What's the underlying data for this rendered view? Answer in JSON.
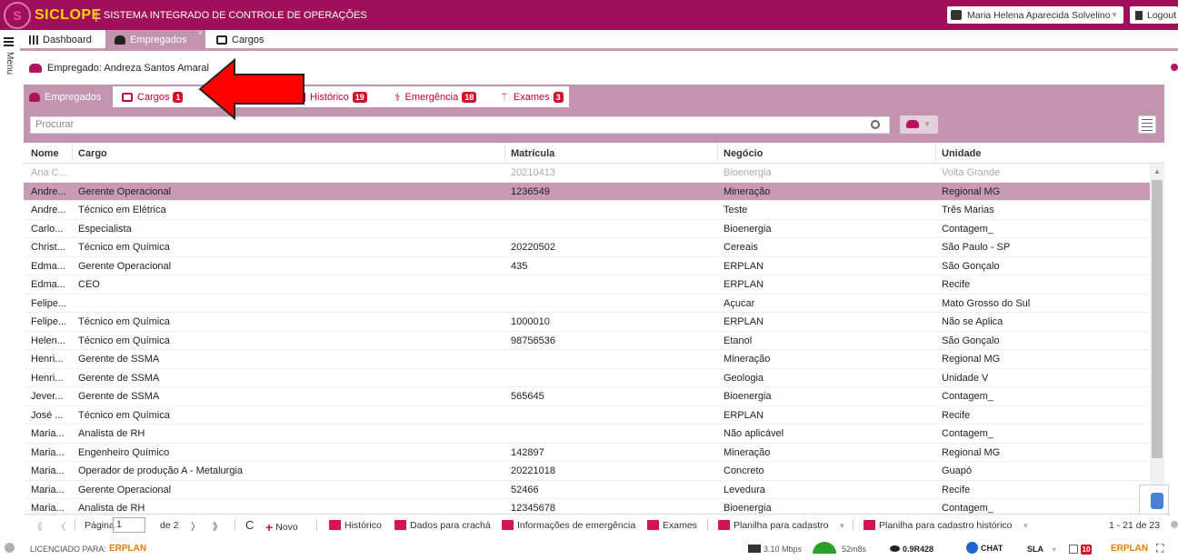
{
  "header": {
    "logo_letter": "S",
    "app_name": "SICLOPE",
    "separator": "|",
    "app_subtitle": "SISTEMA INTEGRADO DE CONTROLE DE OPERAÇÕES",
    "user_name": "Maria Helena Aparecida Solvelino",
    "logout_label": "Logout"
  },
  "menu": {
    "label": "Menu"
  },
  "main_tabs": [
    {
      "label": "Dashboard"
    },
    {
      "label": "Empregados",
      "active": true,
      "close": "×"
    },
    {
      "label": "Cargos"
    }
  ],
  "employee_title": "Empregado: Andreza Santos Amaral",
  "sub_tabs": [
    {
      "label": "Empregados",
      "active": true
    },
    {
      "label": "Cargos",
      "badge": "1"
    },
    {
      "label": "Histórico",
      "badge": "19"
    },
    {
      "label": "Emergência",
      "badge": "18"
    },
    {
      "label": "Exames",
      "badge": "3"
    }
  ],
  "search": {
    "placeholder": "Procurar"
  },
  "table": {
    "headers": [
      "Nome",
      "Cargo",
      "Matrícula",
      "Negócio",
      "Unidade"
    ],
    "rows": [
      [
        "Ana C...",
        "",
        "20210413",
        "Bioenergia",
        "Volta Grande"
      ],
      [
        "Andre...",
        "Gerente Operacional",
        "1236549",
        "Mineração",
        "Regional MG"
      ],
      [
        "Andre...",
        "Técnico em Elétrica",
        "",
        "Teste",
        "Três Marias"
      ],
      [
        "Carlo...",
        "Especialista",
        "",
        "Bioenergia",
        "Contagem_"
      ],
      [
        "Christ...",
        "Técnico em Química",
        "20220502",
        "Cereais",
        "São Paulo - SP"
      ],
      [
        "Edma...",
        "Gerente Operacional",
        "435",
        "ERPLAN",
        "São Gonçalo"
      ],
      [
        "Edma...",
        "CEO",
        "",
        "ERPLAN",
        "Recife"
      ],
      [
        "Felipe...",
        "",
        "",
        "Açucar",
        "Mato Grosso do Sul"
      ],
      [
        "Felipe...",
        "Técnico em Química",
        "1000010",
        "ERPLAN",
        "Não se Aplica"
      ],
      [
        "Helen...",
        "Técnico em Química",
        "98756536",
        "Etanol",
        "São Gonçalo"
      ],
      [
        "Henri...",
        "Gerente de SSMA",
        "",
        "Mineração",
        "Regional MG"
      ],
      [
        "Henri...",
        "Gerente de SSMA",
        "",
        "Geologia",
        "Unidade V"
      ],
      [
        "Jever...",
        "Gerente de SSMA",
        "565645",
        "Bioenergia",
        "Contagem_"
      ],
      [
        "José ...",
        "Técnico em Química",
        "",
        "ERPLAN",
        "Recife"
      ],
      [
        "Maria...",
        "Analista de RH",
        "",
        "Não aplicável",
        "Contagem_"
      ],
      [
        "Maria...",
        "Engenheiro Químico",
        "142897",
        "Mineração",
        "Regional MG"
      ],
      [
        "Maria...",
        "Operador de produção A - Metalurgia",
        "20221018",
        "Concreto",
        "Guapó"
      ],
      [
        "Maria...",
        "Gerente Operacional",
        "52466",
        "Levedura",
        "Recife"
      ],
      [
        "Maria...",
        "Analista de RH",
        "12345678",
        "Bioenergia",
        "Contagem_"
      ]
    ],
    "selected_row": 1,
    "dim_row": 0
  },
  "pager": {
    "first": "《",
    "prev": "〈",
    "page_label": "Página",
    "page_value": "1",
    "of_label": "de 2",
    "next": "〉",
    "last": "》",
    "refresh": "C",
    "new_label": "Novo",
    "historico_label": "Histórico",
    "cracha_label": "Dados para crachá",
    "emergencia_label": "Informações de emergência",
    "exames_label": "Exames",
    "planilha_label": "Planilha para cadastro",
    "planilha_hist_label": "Planilha para cadastro histórico",
    "range_label": "1 - 21 de 23"
  },
  "statusbar": {
    "licensed_label": "LICENCIADO PARA:",
    "erplan": "ERPLAN",
    "speed": "3.10 Mbps",
    "latency": "52m8s",
    "version": "0.9R428",
    "chat": "CHAT",
    "sla": "SLA",
    "count_badge": "10",
    "erplan_right": "ERPLAN"
  },
  "colors": {
    "brand": "#a0105a",
    "tab_active": "#c294ad",
    "badge": "#d40f2a",
    "arrow": "#ff0000"
  }
}
